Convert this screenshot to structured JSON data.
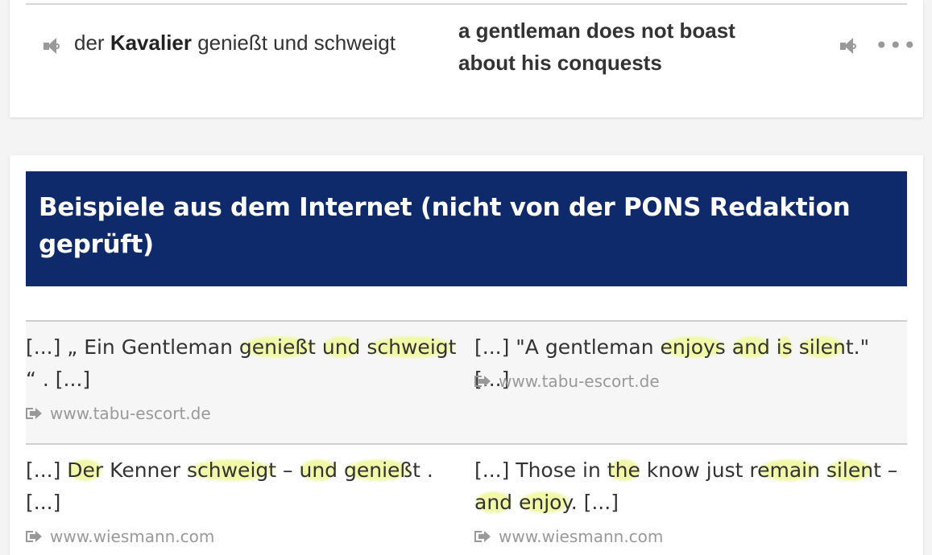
{
  "entry": {
    "source_prefix": "der ",
    "source_keyword": "Kavalier",
    "source_suffix": " genießt und schweigt",
    "target": "a gentleman does not boast about his conquests",
    "more_label": "•••"
  },
  "examples_section": {
    "title": "Beispiele aus dem Internet (nicht von der PONS Redaktion geprüft)"
  },
  "examples": [
    {
      "de": [
        {
          "t": "[...] „ Ein Gentleman "
        },
        {
          "t": "genießt",
          "hl": true
        },
        {
          "t": " "
        },
        {
          "t": "und",
          "hl": true
        },
        {
          "t": " "
        },
        {
          "t": "schweigt",
          "hl": true
        },
        {
          "t": " “ . [...]"
        }
      ],
      "en": [
        {
          "t": "[...] \"A gentleman "
        },
        {
          "t": "enjoys",
          "hl": true
        },
        {
          "t": " "
        },
        {
          "t": "and",
          "hl": true
        },
        {
          "t": " "
        },
        {
          "t": "is",
          "hl": true
        },
        {
          "t": " "
        },
        {
          "t": "silen",
          "hl": true
        },
        {
          "t": "t.\" [...]"
        }
      ],
      "de_source": "www.tabu-escort.de",
      "en_source": "www.tabu-escort.de"
    },
    {
      "de": [
        {
          "t": "[...] "
        },
        {
          "t": "Der",
          "hl": true
        },
        {
          "t": " Kenner "
        },
        {
          "t": "schweigt",
          "hl": true
        },
        {
          "t": " – "
        },
        {
          "t": "und",
          "hl": true
        },
        {
          "t": " "
        },
        {
          "t": "genieß",
          "hl": true
        },
        {
          "t": "t . [...]"
        }
      ],
      "en": [
        {
          "t": "[...] Those in "
        },
        {
          "t": "the",
          "hl": true
        },
        {
          "t": " know just r"
        },
        {
          "t": "emain",
          "hl": true
        },
        {
          "t": " "
        },
        {
          "t": "silen",
          "hl": true
        },
        {
          "t": "t – "
        },
        {
          "t": "and",
          "hl": true
        },
        {
          "t": " "
        },
        {
          "t": "enjoy",
          "hl": true
        },
        {
          "t": ". [...]"
        }
      ],
      "de_source": "www.wiesmann.com",
      "en_source": "www.wiesmann.com"
    }
  ]
}
